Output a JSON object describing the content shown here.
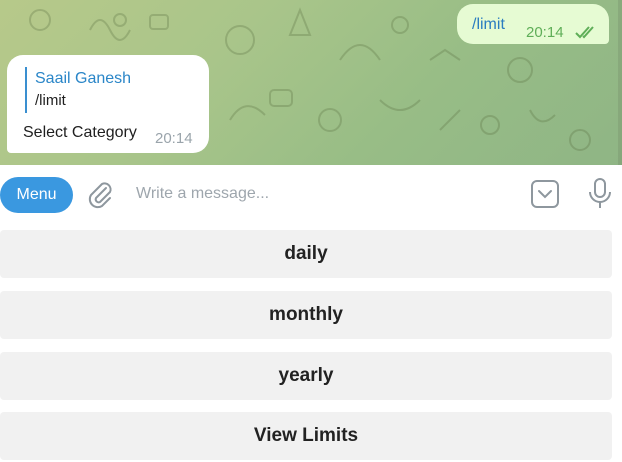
{
  "chat": {
    "outgoing": {
      "text": "/limit",
      "time": "20:14",
      "status": "read"
    },
    "incoming": {
      "reply_author": "Saail Ganesh",
      "reply_text": "/limit",
      "text": "Select Category",
      "time": "20:14"
    }
  },
  "composer": {
    "menu_label": "Menu",
    "placeholder": "Write a message..."
  },
  "keyboard": {
    "buttons": [
      "daily",
      "monthly",
      "yearly",
      "View Limits"
    ]
  },
  "colors": {
    "accent": "#3a98e0",
    "outgoing_bubble": "#e6fbd3",
    "read_ticks": "#5fae58",
    "keyboard_button": "#f1f1f1"
  },
  "icons": [
    "attach-icon",
    "keyboard-toggle-icon",
    "microphone-icon",
    "read-ticks-icon"
  ]
}
